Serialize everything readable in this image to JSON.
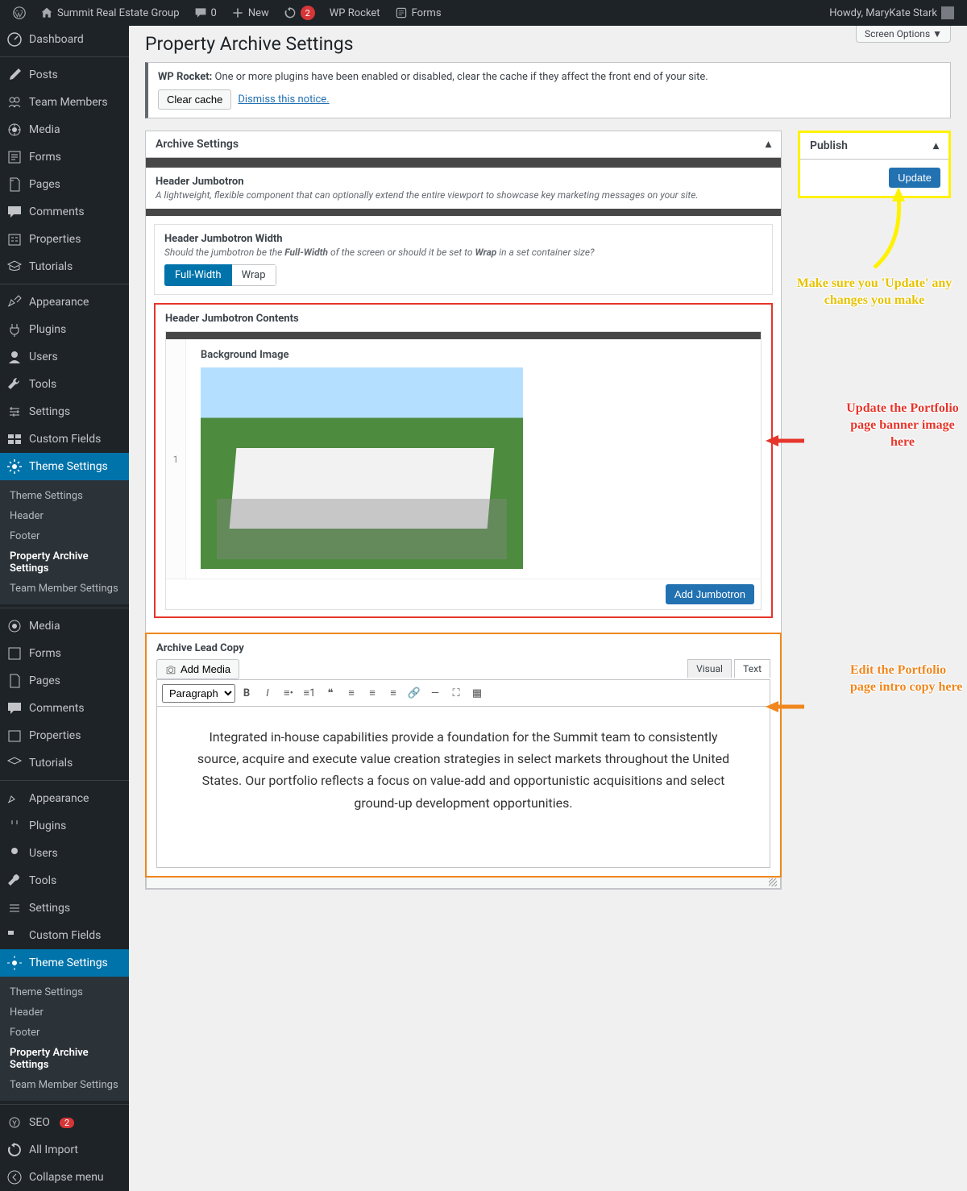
{
  "adminbar": {
    "site_name": "Summit Real Estate Group",
    "comments_count": "0",
    "new_label": "New",
    "updates_count": "2",
    "wp_rocket": "WP Rocket",
    "forms": "Forms",
    "howdy": "Howdy, MaryKate Stark"
  },
  "sidebar": {
    "dashboard": "Dashboard",
    "posts": "Posts",
    "team_members": "Team Members",
    "media": "Media",
    "forms": "Forms",
    "pages": "Pages",
    "comments": "Comments",
    "properties": "Properties",
    "tutorials": "Tutorials",
    "appearance": "Appearance",
    "plugins": "Plugins",
    "users": "Users",
    "tools": "Tools",
    "settings": "Settings",
    "custom_fields": "Custom Fields",
    "theme_settings": "Theme Settings",
    "sub": {
      "theme_settings": "Theme Settings",
      "header": "Header",
      "footer": "Footer",
      "property_archive": "Property Archive Settings",
      "team_member": "Team Member Settings"
    },
    "seo": "SEO",
    "seo_badge": "2",
    "all_import": "All Import",
    "collapse": "Collapse menu"
  },
  "page": {
    "title": "Property Archive Settings",
    "screen_options": "Screen Options"
  },
  "notice": {
    "plugin": "WP Rocket:",
    "text": " One or more plugins have been enabled or disabled, clear the cache if they affect the front end of your site.",
    "clear_cache": "Clear cache",
    "dismiss": "Dismiss this notice."
  },
  "archive": {
    "panel_title": "Archive Settings",
    "hj_title": "Header Jumbotron",
    "hj_desc": "A lightweight, flexible component that can optionally extend the entire viewport to showcase key marketing messages on your site.",
    "hjw_title": "Header Jumbotron Width",
    "hjw_desc_pre": "Should the jumbotron be the ",
    "hjw_full": "Full-Width",
    "hjw_desc_mid": " of the screen or should it be set to ",
    "hjw_wrap": "Wrap",
    "hjw_desc_post": " in a set container size?",
    "opt_full": "Full-Width",
    "opt_wrap": "Wrap",
    "hjc_title": "Header Jumbotron Contents",
    "row_num": "1",
    "bg_label": "Background Image",
    "add_jumbotron": "Add Jumbotron"
  },
  "lead": {
    "title": "Archive Lead Copy",
    "add_media": "Add Media",
    "tab_visual": "Visual",
    "tab_text": "Text",
    "paragraph": "Paragraph",
    "body": "Integrated in-house capabilities provide a foundation for the Summit team to consistently source, acquire and execute value creation strategies in select markets throughout the United States. Our portfolio reflects a focus on value-add and opportunistic acquisitions and select ground-up development opportunities."
  },
  "publish": {
    "title": "Publish",
    "update": "Update"
  },
  "annot": {
    "yellow": "Make sure you 'Update' any changes you make",
    "red": "Update the Portfolio page banner image here",
    "orange": "Edit the Portfolio page intro copy here"
  }
}
